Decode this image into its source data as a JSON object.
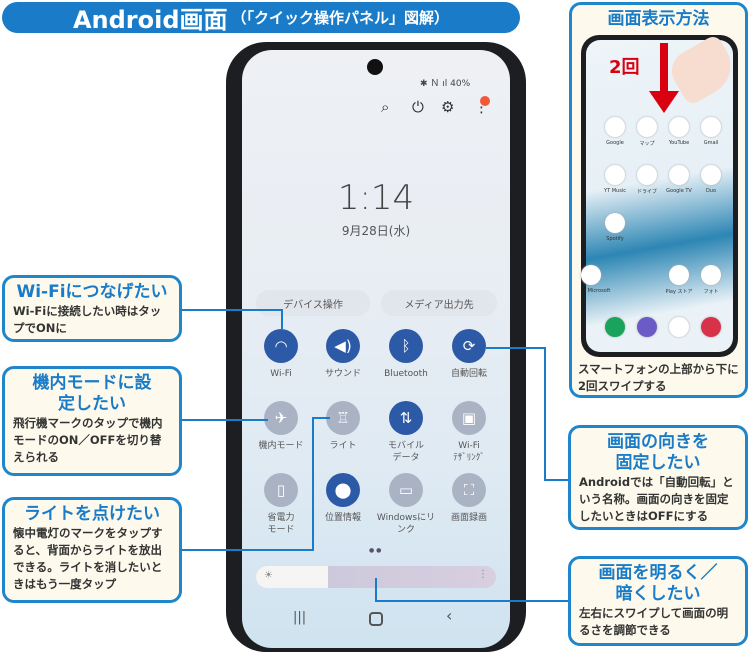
{
  "header": {
    "title": "Android画面",
    "subtitle": "（「クイック操作パネル」図解）"
  },
  "phone": {
    "status": {
      "battery": "40%"
    },
    "top_icons": [
      "search-icon",
      "power-icon",
      "gear-icon",
      "more-icon"
    ],
    "clock": "1:14",
    "date": "9月28日(水)",
    "pills": [
      "デバイス操作",
      "メディア出力先"
    ],
    "tiles": [
      {
        "label": "Wi-Fi",
        "icon": "wifi-icon",
        "state": "on"
      },
      {
        "label": "サウンド",
        "icon": "speaker-icon",
        "state": "on"
      },
      {
        "label": "Bluetooth",
        "icon": "bluetooth-icon",
        "state": "on"
      },
      {
        "label": "自動回転",
        "icon": "rotate-icon",
        "state": "on"
      },
      {
        "label": "機内モード",
        "icon": "airplane-icon",
        "state": "off"
      },
      {
        "label": "ライト",
        "icon": "flashlight-icon",
        "state": "off"
      },
      {
        "label": "モバイル\nデータ",
        "icon": "mobile-data-icon",
        "state": "on"
      },
      {
        "label": "Wi-Fi\nﾃｻﾞﾘﾝｸﾞ",
        "icon": "hotspot-icon",
        "state": "off"
      },
      {
        "label": "省電力\nモード",
        "icon": "battery-saver-icon",
        "state": "off"
      },
      {
        "label": "位置情報",
        "icon": "location-icon",
        "state": "on"
      },
      {
        "label": "Windowsにリ\nンク",
        "icon": "link-windows-icon",
        "state": "off"
      },
      {
        "label": "画面録画",
        "icon": "screen-record-icon",
        "state": "off"
      }
    ],
    "brightness": 0.3,
    "nav": [
      "recents-icon",
      "home-icon",
      "back-icon"
    ]
  },
  "callouts": {
    "wifi": {
      "title": "Wi-Fiにつなげたい",
      "text": "Wi-Fiに接続したい時はタップでONに"
    },
    "airplane": {
      "title": "機内モードに設定したい",
      "text": "飛行機マークのタップで機内モードのON／OFFを切り替えられる"
    },
    "light": {
      "title": "ライトを点けたい",
      "text": "懐中電灯のマークをタップすると、背面からライトを放出できる。ライトを消したいときはもう一度タップ"
    },
    "howto": {
      "title": "画面表示方法",
      "badge": "2回",
      "text": "スマートフォンの上部から下に2回スワイプする",
      "apps": [
        "Google",
        "マップ",
        "YouTube",
        "Gmail",
        "YT Music",
        "ドライブ",
        "Google TV",
        "Duo",
        "Spotify",
        "",
        "Play ストア",
        "フォト",
        "Microsoft"
      ]
    },
    "rotate": {
      "title": "画面の向きを固定したい",
      "text": "Androidでは「自動回転」という名称。画面の向きを固定したいときはOFFにする"
    },
    "bright": {
      "title": "画面を明るく／暗くしたい",
      "text": "左右にスワイプして画面の明るさを調節できる"
    }
  },
  "colors": {
    "accent": "#1a7cc8",
    "tile_on": "#2d5aa6",
    "tile_off": "#a9b3c4",
    "box_bg": "#fdf9ec",
    "arrow": "#d9000f"
  }
}
